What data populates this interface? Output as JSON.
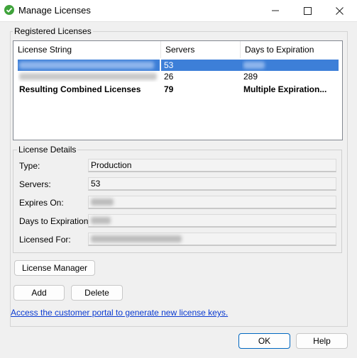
{
  "window": {
    "title": "Manage Licenses",
    "icon": "green-check-icon",
    "controls": [
      "minimize",
      "maximize",
      "close"
    ]
  },
  "registered_licenses": {
    "group_label": "Registered Licenses",
    "columns": [
      "License String",
      "Servers",
      "Days to Expiration"
    ],
    "rows": [
      {
        "license": "",
        "servers": "53",
        "days": "",
        "selected": true
      },
      {
        "license": "",
        "servers": "26",
        "days": "289",
        "selected": false
      },
      {
        "license": "Resulting Combined Licenses",
        "servers": "79",
        "days": "Multiple Expiration...",
        "bold": true
      }
    ]
  },
  "license_details": {
    "group_label": "License Details",
    "type_label": "Type:",
    "type_value": "Production",
    "servers_label": "Servers:",
    "servers_value": "53",
    "expires_label": "Expires On:",
    "expires_value": "",
    "days_label": "Days to Expiration:",
    "days_value": "",
    "licensed_for_label": "Licensed For:",
    "licensed_for_value": ""
  },
  "buttons": {
    "license_manager": "License Manager",
    "add": "Add",
    "delete": "Delete",
    "ok": "OK",
    "help": "Help"
  },
  "portal_link": "Access the customer portal to generate new license keys.",
  "colors": {
    "selection": "#3d7fd8",
    "link": "#0b3bd1",
    "icon_green": "#3fa33b"
  }
}
